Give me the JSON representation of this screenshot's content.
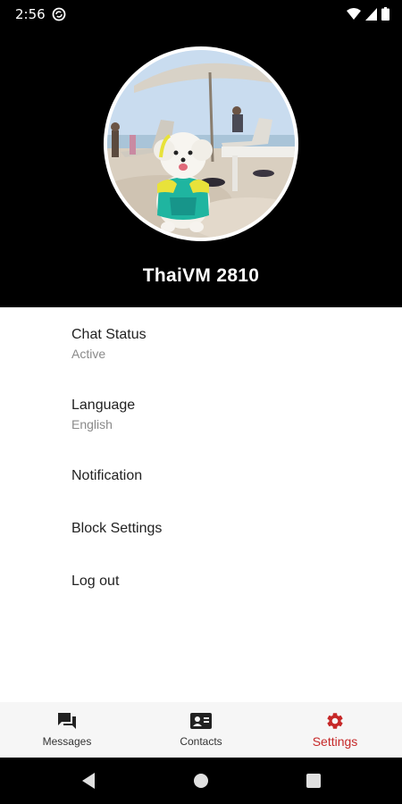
{
  "status_bar": {
    "time": "2:56"
  },
  "profile": {
    "name": "ThaiVM 2810"
  },
  "menu": {
    "chat_status": {
      "title": "Chat Status",
      "subtitle": "Active"
    },
    "language": {
      "title": "Language",
      "subtitle": "English"
    },
    "notification": {
      "title": "Notification"
    },
    "block_settings": {
      "title": "Block Settings"
    },
    "logout": {
      "title": "Log out"
    }
  },
  "bottom_nav": {
    "items": [
      {
        "label": "Messages",
        "icon": "chat-bubbles-icon",
        "active": false
      },
      {
        "label": "Contacts",
        "icon": "contact-card-icon",
        "active": false
      },
      {
        "label": "Settings",
        "icon": "gear-icon",
        "active": true
      }
    ]
  },
  "colors": {
    "accent": "#c62828",
    "header_bg": "#000000",
    "nav_bg": "#f6f6f6"
  }
}
